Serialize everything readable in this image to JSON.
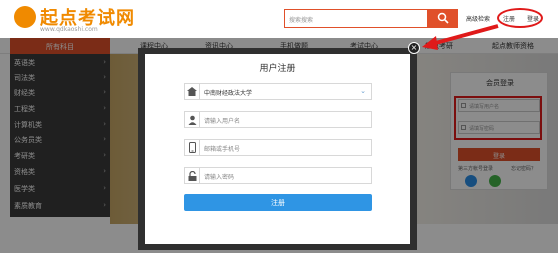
{
  "logo": {
    "name": "起点考试网",
    "url_text": "www.qdkaoshi.com"
  },
  "search": {
    "placeholder": "搜索搜索"
  },
  "header_links": {
    "advanced_search": "高级检索",
    "register": "注册",
    "login": "登录"
  },
  "nav": {
    "items": [
      "课程中心",
      "资讯中心",
      "手机做题",
      "考试中心",
      "起点考研",
      "起点教师资格"
    ]
  },
  "sidebar": {
    "title": "所有科目",
    "items": [
      "英语类",
      "司法类",
      "财经类",
      "工程类",
      "计算机类",
      "公务员类",
      "考研类",
      "资格类",
      "医学类",
      "素质教育"
    ]
  },
  "modal": {
    "title": "用户注册",
    "school_value": "中南财经政法大学",
    "username_placeholder": "请输入用户名",
    "phone_placeholder": "邮箱或手机号",
    "password_placeholder": "请输入密码",
    "submit_label": "注册",
    "close_label": "×"
  },
  "login_panel": {
    "title": "会员登录",
    "username_placeholder": "请填写用户名",
    "password_placeholder": "请填写密码",
    "submit_label": "登录",
    "third_party_label": "第三方帐号登录",
    "forgot_label": "忘记密码？"
  },
  "colors": {
    "brand": "#e0502a",
    "annotation": "#e01a1a",
    "submit_blue": "#2f95e4"
  }
}
